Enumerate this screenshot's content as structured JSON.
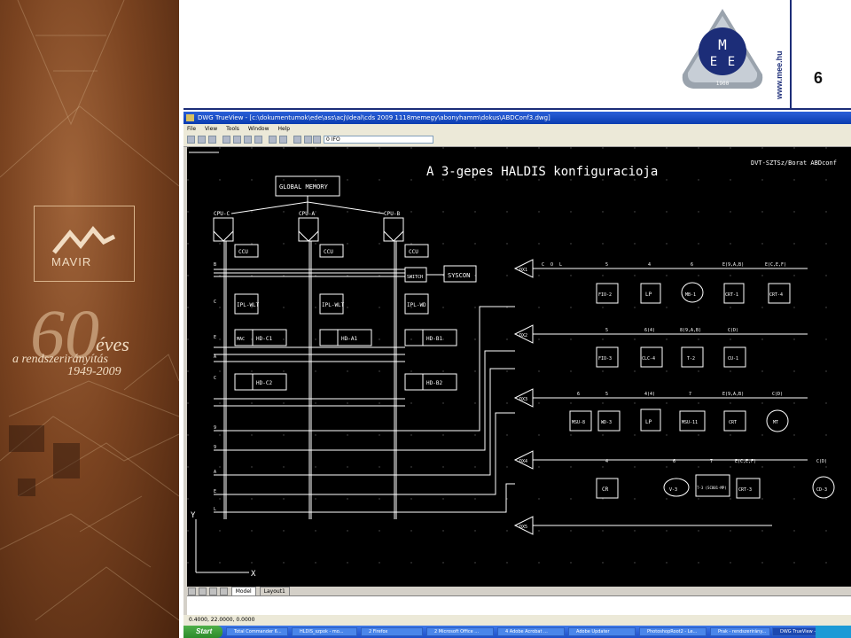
{
  "slide": {
    "page_number": "6",
    "org_url": "www.mee.hu",
    "mee_logo_letters": [
      "M",
      "E",
      "E"
    ],
    "mee_logo_text": "MAGYAR ELEKTROTECHNIKAI EGYESÜLET",
    "mee_logo_year": "1900",
    "colors": {
      "accent": "#1c2d78",
      "panel": "#7a4320"
    }
  },
  "left_panel": {
    "brand": "MAVIR",
    "anniversary_number": "60",
    "anniversary_word": "éves",
    "tagline": "a rendszerirányítás",
    "years": "1949-2009"
  },
  "app": {
    "title": "DWG TrueView - [c:\\dokumentumok\\ede\\ass\\acj\\Ideal\\cds 2009 1118memegy\\abonyhamm\\dokus\\ABDConf3.dwg]",
    "menu": [
      "File",
      "View",
      "Tools",
      "Window",
      "Help"
    ],
    "layer_value": "0 IFO",
    "tabs": [
      "Model",
      "Layout1"
    ],
    "active_tab": "Model",
    "status_coords": "0.4000, 22.0000, 0.0000",
    "ucs_y": "Y",
    "ucs_x": "X"
  },
  "taskbar": {
    "start": "Start",
    "items": [
      "Total Commander 6...",
      "HLDIS_szpok - mo...",
      "2 Firefox",
      "2 Microsoft Office ...",
      "4 Adobe Acrobat ...",
      "Adobe Updater",
      "PhotoshopRoot2 - Le...",
      "Prak - rendszerirány...",
      "DWG TrueView - [c:\\..."
    ],
    "active_index": 8
  },
  "drawing": {
    "title": "A 3-gepes HALDIS konfiguracioja",
    "corner_label": "DVT-SZTSz/Borat ABDconf",
    "global_memory": "GLOBAL MEMORY",
    "cpus": [
      "CPU-C",
      "CPU-A",
      "CPU-B"
    ],
    "ccu": [
      "CCU",
      "CCU",
      "CCU"
    ],
    "ipl": [
      "IPL-WLT",
      "IPL-WLT",
      "IPL-WD"
    ],
    "switch": "SWITCH",
    "syscon": "SYSCON",
    "disk_ctrl": [
      "HD-C1",
      "HD-A1",
      "HD-B1",
      "HD-C2",
      "HD-B2"
    ],
    "mac": "MAC",
    "cu_labels": [
      "DX1",
      "DX2",
      "DX3",
      "DX4",
      "DX5"
    ],
    "bus_sides": [
      "C",
      "O",
      "L"
    ],
    "left_bus_labels": [
      "B",
      "C",
      "E",
      "A",
      "C",
      "9",
      "9",
      "A",
      "E",
      "L",
      "B",
      "A",
      "9",
      "7",
      "8",
      "9",
      "A",
      "B"
    ],
    "devices_row1": [
      "FIO-2",
      "LP",
      "MB-1",
      "CRT-1",
      "CRT-4"
    ],
    "devices_row2": [
      "FIO-3",
      "CLC-4",
      "T-2",
      "CU-1"
    ],
    "devices_row3": [
      "MSU-8",
      "WD-3",
      "LP",
      "MSU-11",
      "CRT",
      "MT"
    ],
    "devices_row4": [
      "CR",
      "V-3",
      "T-3 (SC801-MP)",
      "CRT-3",
      "CD-3"
    ],
    "row1_codes": [
      "5",
      "4",
      "6",
      "E(9,A,B)",
      "E(C,E,F)"
    ],
    "row2_codes": [
      "5",
      "6(4)",
      "8(9,A,B)",
      "C(D)"
    ],
    "row3_codes": [
      "6",
      "5",
      "4(4)",
      "7",
      "E(9,A,B)",
      "C(D)"
    ],
    "row4_codes": [
      "4",
      "6",
      "7",
      "E(C,E,F)",
      "C(D)"
    ]
  }
}
